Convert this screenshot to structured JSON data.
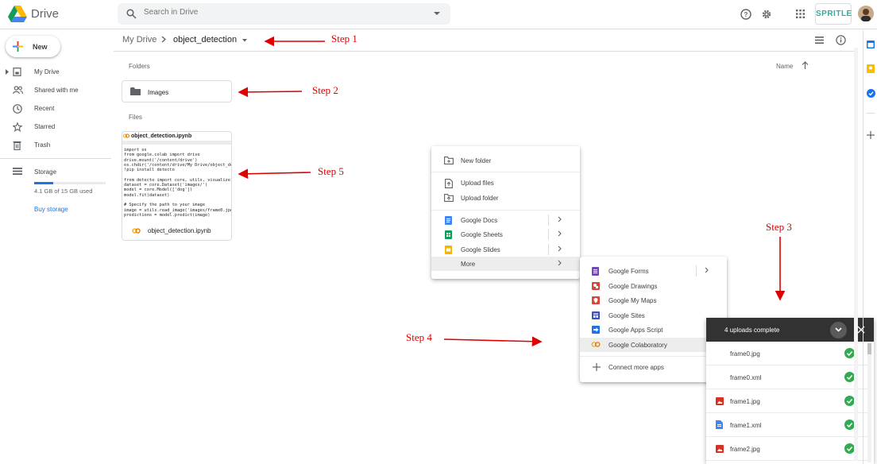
{
  "header": {
    "app_name": "Drive",
    "search_placeholder": "Search in Drive",
    "brand": "SPRITLE"
  },
  "breadcrumb": {
    "root": "My Drive",
    "current": "object_detection"
  },
  "sidebar": {
    "new_label": "New",
    "items": [
      {
        "label": "My Drive",
        "icon": "my-drive-icon"
      },
      {
        "label": "Shared with me",
        "icon": "people-icon"
      },
      {
        "label": "Recent",
        "icon": "clock-icon"
      },
      {
        "label": "Starred",
        "icon": "star-icon"
      },
      {
        "label": "Trash",
        "icon": "trash-icon"
      }
    ],
    "storage_label": "Storage",
    "storage_used": "4.1 GB of 15 GB used",
    "storage_fraction": 0.27,
    "buy_storage": "Buy storage"
  },
  "main": {
    "folders_label": "Folders",
    "sort_label": "Name",
    "folder_name": "Images",
    "files_label": "Files",
    "file_title": "object_detection.ipynb",
    "file_name": "object_detection.ipynb",
    "code_preview": "import os\nfrom google.colab import drive\ndrive.mount('/content/drive')\nos.chdir('/content/drive/My Drive/object_det\n!pip install detecto\n\nfrom detecto import core, utils, visualize\ndataset = core.Dataset('images/')\nmodel = core.Model(['dog'])\nmodel.fit(dataset)\n\n# Specify the path to your image\nimage = utils.read_image('images/frame0.jpg')\npredictions = model.predict(image)"
  },
  "context_menu": {
    "new_folder": "New folder",
    "upload_files": "Upload files",
    "upload_folder": "Upload folder",
    "google_docs": "Google Docs",
    "google_sheets": "Google Sheets",
    "google_slides": "Google Slides",
    "more": "More"
  },
  "submenu": {
    "items": [
      "Google Forms",
      "Google Drawings",
      "Google My Maps",
      "Google Sites",
      "Google Apps Script",
      "Google Colaboratory"
    ],
    "connect": "Connect more apps"
  },
  "upload_panel": {
    "title": "4 uploads complete",
    "files": [
      "frame0.jpg",
      "frame0.xml",
      "frame1.jpg",
      "frame1.xml",
      "frame2.jpg"
    ]
  },
  "annotations": {
    "step1": "Step 1",
    "step2": "Step 2",
    "step3": "Step 3",
    "step4": "Step 4",
    "step5": "Step 5"
  },
  "colors": {
    "accent_blue": "#1a73e8",
    "annotation_red": "#e00000",
    "success_green": "#34a853",
    "docs_blue": "#4285f4",
    "sheets_green": "#0f9d58",
    "slides_yellow": "#f4b400",
    "forms_purple": "#7248b9",
    "drawings_red": "#db4437"
  }
}
